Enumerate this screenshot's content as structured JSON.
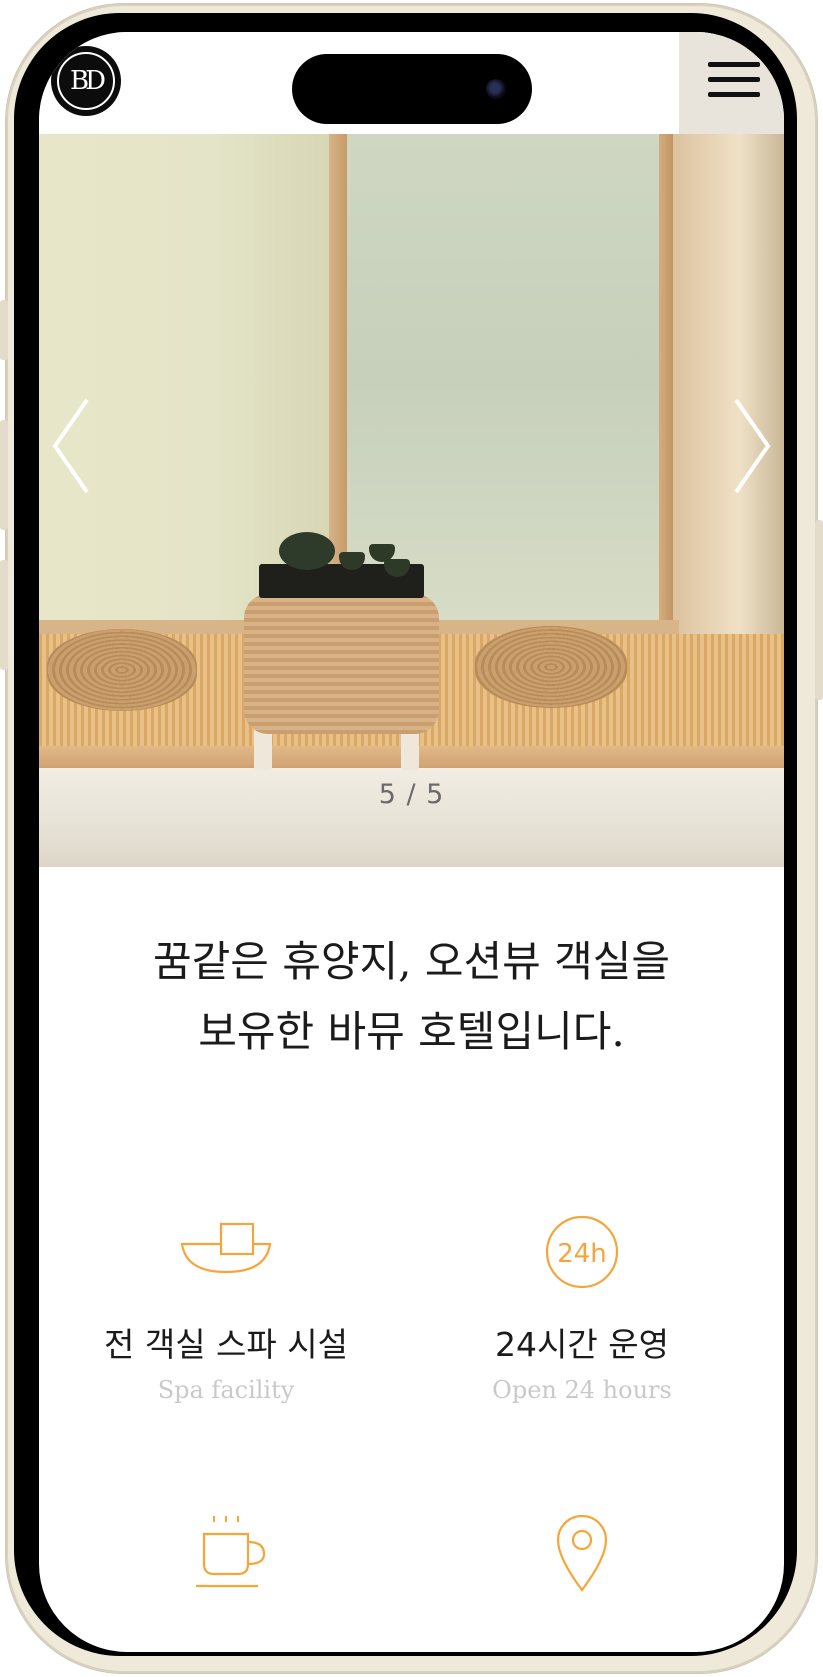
{
  "header": {
    "logo_text": "BD",
    "menu_icon": "hamburger-icon"
  },
  "hero": {
    "prev_icon": "chevron-left-icon",
    "next_icon": "chevron-right-icon",
    "counter": "5 / 5"
  },
  "intro": {
    "line1": "꿈같은 휴양지, 오션뷰 객실을",
    "line2": "보유한 바뮤 호텔입니다."
  },
  "features": [
    {
      "icon": "spa-tub-icon",
      "title": "전 객실 스파 시설",
      "subtitle": "Spa facility"
    },
    {
      "icon": "24h-icon",
      "icon_text": "24h",
      "title": "24시간 운영",
      "subtitle": "Open 24 hours"
    },
    {
      "icon": "coffee-cup-icon",
      "title": "",
      "subtitle": ""
    },
    {
      "icon": "location-pin-icon",
      "title": "",
      "subtitle": ""
    }
  ],
  "colors": {
    "accent": "#f5a53a",
    "frame": "#efe9da",
    "menu_bg": "#e8e4dc",
    "text_dark": "#1b1b1b",
    "text_muted": "#c9c9c9"
  }
}
